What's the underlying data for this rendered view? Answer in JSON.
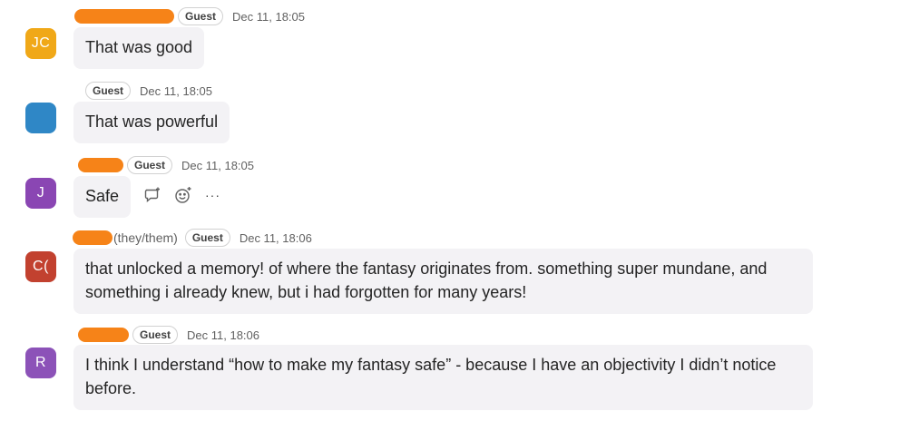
{
  "messages": [
    {
      "avatar_initials": "JC",
      "avatar_color": "#f0a818",
      "pronouns": "",
      "badge": "Guest",
      "timestamp": "Dec 11, 18:05",
      "text": "That was good"
    },
    {
      "avatar_initials": "",
      "avatar_color": "#2f87c6",
      "pronouns": "",
      "badge": "Guest",
      "timestamp": "Dec 11, 18:05",
      "text": "That was powerful"
    },
    {
      "avatar_initials": "J",
      "avatar_color": "#8a46b3",
      "pronouns": "",
      "badge": "Guest",
      "timestamp": "Dec 11, 18:05",
      "text": "Safe"
    },
    {
      "avatar_initials": "C(",
      "avatar_color": "#c2412f",
      "pronouns": "(they/them)",
      "badge": "Guest",
      "timestamp": "Dec 11, 18:06",
      "text": "that unlocked a memory! of where the fantasy originates from. something super mundane, and something i already knew, but i had forgotten for many years!"
    },
    {
      "avatar_initials": "R",
      "avatar_color": "#8c52b8",
      "pronouns": "",
      "badge": "Guest",
      "timestamp": "Dec 11, 18:06",
      "text": "I think I understand “how to make my fantasy safe” - because I have an objectivity I didn’t notice before."
    }
  ],
  "hover_actions": {
    "icons": [
      "reply-icon",
      "add-reaction-icon",
      "more-options-icon"
    ],
    "more_label": "···"
  },
  "colors": {
    "bubble_bg": "#f3f2f5",
    "redaction": "#f68318",
    "timestamp": "#616161"
  }
}
